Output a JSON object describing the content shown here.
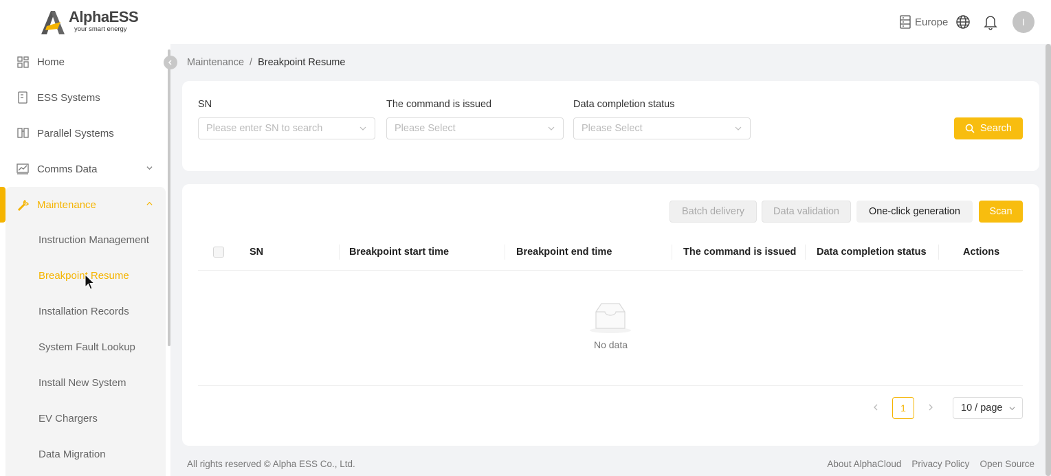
{
  "brand": {
    "name": "AlphaESS",
    "tagline": "your smart energy",
    "accent": "#f5b400"
  },
  "topbar": {
    "region": "Europe",
    "avatar_initial": "I"
  },
  "sidebar": {
    "items": [
      {
        "label": "Home",
        "icon": "dashboard-icon"
      },
      {
        "label": "ESS Systems",
        "icon": "battery-icon"
      },
      {
        "label": "Parallel Systems",
        "icon": "parallel-icon"
      },
      {
        "label": "Comms Data",
        "icon": "chart-icon"
      },
      {
        "label": "Maintenance",
        "icon": "wrench-icon"
      }
    ],
    "submenu": [
      "Instruction Management",
      "Breakpoint Resume",
      "Installation Records",
      "System Fault Lookup",
      "Install New System",
      "EV Chargers",
      "Data Migration"
    ]
  },
  "breadcrumb": {
    "parent": "Maintenance",
    "separator": "/",
    "current": "Breakpoint Resume"
  },
  "filters": {
    "sn": {
      "label": "SN",
      "placeholder": "Please enter SN to search"
    },
    "command": {
      "label": "The command is issued",
      "placeholder": "Please Select"
    },
    "completion": {
      "label": "Data completion status",
      "placeholder": "Please Select"
    },
    "search_label": "Search"
  },
  "toolbar": {
    "batch_delivery": "Batch delivery",
    "data_validation": "Data validation",
    "one_click": "One-click generation",
    "scan": "Scan"
  },
  "table": {
    "columns": [
      "SN",
      "Breakpoint start time",
      "Breakpoint end time",
      "The command is issued",
      "Data completion status",
      "Actions"
    ],
    "empty_text": "No data"
  },
  "pagination": {
    "current_page": "1",
    "page_size": "10 / page"
  },
  "footer": {
    "copyright": "All rights reserved © Alpha ESS Co., Ltd.",
    "links": [
      "About AlphaCloud",
      "Privacy Policy",
      "Open Source"
    ]
  }
}
